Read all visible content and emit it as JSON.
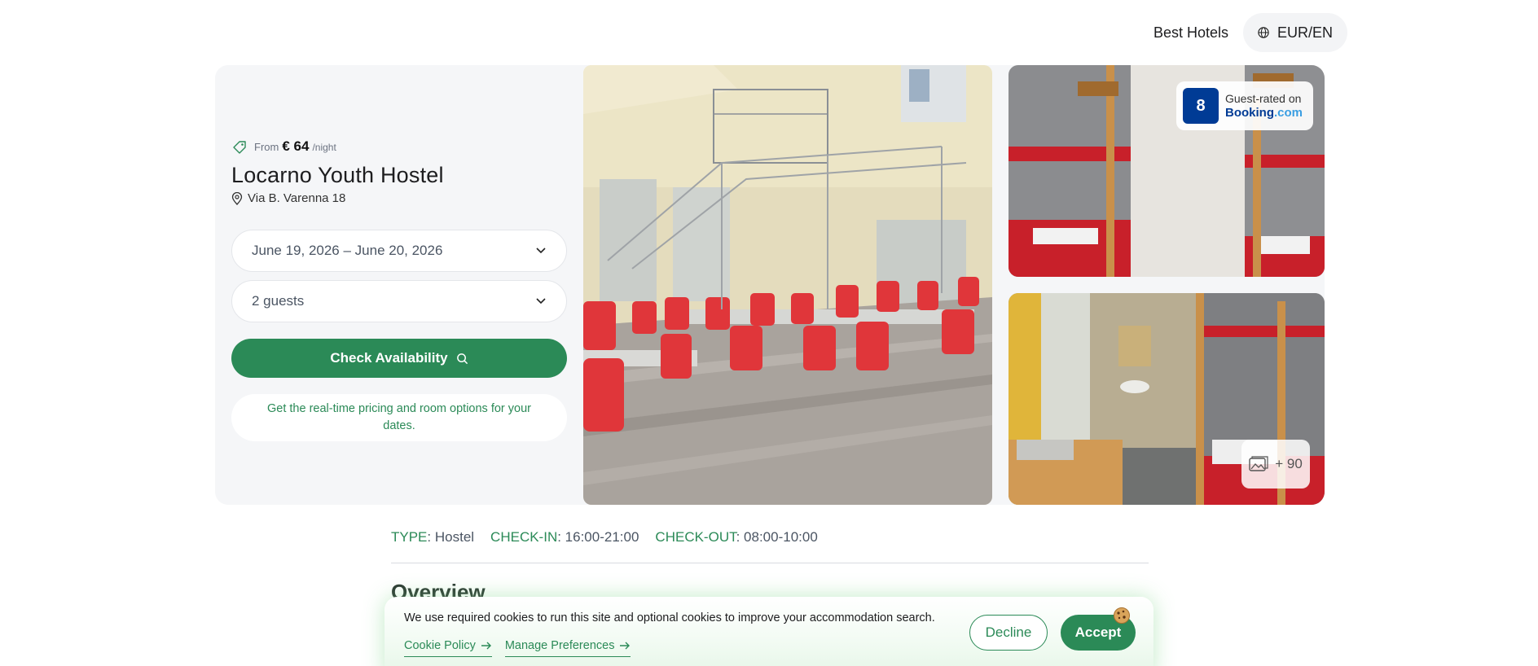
{
  "header": {
    "brand_link": "Best Hotels",
    "currency_locale": "EUR/EN"
  },
  "hostel": {
    "price_from": "From",
    "price_value": "€ 64",
    "price_unit": "/night",
    "name": "Locarno Youth Hostel",
    "address": "Via B. Varenna 18"
  },
  "booking_form": {
    "dates": "June 19, 2026 – June 20, 2026",
    "guests": "2 guests",
    "cta": "Check Availability",
    "note": "Get the real-time pricing and room options for your dates."
  },
  "rating": {
    "score": "8",
    "label": "Guest-rated on",
    "provider_main": "Booking",
    "provider_suffix": ".com"
  },
  "gallery": {
    "more_count": "+ 90"
  },
  "facts": [
    {
      "key": "TYPE",
      "value": "Hostel"
    },
    {
      "key": "CHECK-IN",
      "value": "16:00-21:00"
    },
    {
      "key": "CHECK-OUT",
      "value": "08:00-10:00"
    }
  ],
  "section": {
    "overview_title": "Overview"
  },
  "cookie_banner": {
    "message": "We use required cookies to run this site and optional cookies to improve your accommodation search.",
    "policy_link": "Cookie Policy",
    "preferences_link": "Manage Preferences",
    "decline": "Decline",
    "accept": "Accept"
  },
  "colors": {
    "brand_green": "#2b8a57",
    "booking_blue": "#003b95",
    "panel_bg": "#f5f6f8"
  }
}
